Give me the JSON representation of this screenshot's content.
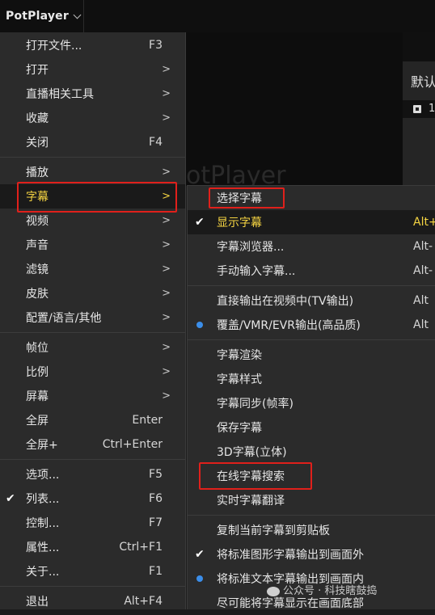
{
  "app": {
    "title": "PotPlayer"
  },
  "video": {
    "watermark": "otPlayer"
  },
  "right_panel": {
    "header": "默认",
    "row_number": "1"
  },
  "main_menu": {
    "items": [
      {
        "label": "打开文件...",
        "shortcut": "F3"
      },
      {
        "label": "打开",
        "submenu": ">"
      },
      {
        "label": "直播相关工具",
        "submenu": ">"
      },
      {
        "label": "收藏",
        "submenu": ">"
      },
      {
        "label": "关闭",
        "shortcut": "F4"
      },
      {
        "label": "播放",
        "submenu": ">"
      },
      {
        "label": "字幕",
        "submenu": ">",
        "highlighted": true
      },
      {
        "label": "视频",
        "submenu": ">"
      },
      {
        "label": "声音",
        "submenu": ">"
      },
      {
        "label": "滤镜",
        "submenu": ">"
      },
      {
        "label": "皮肤",
        "submenu": ">"
      },
      {
        "label": "配置/语言/其他",
        "submenu": ">"
      },
      {
        "label": "帧位",
        "submenu": ">"
      },
      {
        "label": "比例",
        "submenu": ">"
      },
      {
        "label": "屏幕",
        "submenu": ">"
      },
      {
        "label": "全屏",
        "shortcut": "Enter"
      },
      {
        "label": "全屏+",
        "shortcut": "Ctrl+Enter"
      },
      {
        "label": "选项...",
        "shortcut": "F5"
      },
      {
        "label": "列表...",
        "shortcut": "F6",
        "checked": true
      },
      {
        "label": "控制...",
        "shortcut": "F7"
      },
      {
        "label": "属性...",
        "shortcut": "Ctrl+F1"
      },
      {
        "label": "关于...",
        "shortcut": "F1"
      },
      {
        "label": "退出",
        "shortcut": "Alt+F4"
      }
    ]
  },
  "subtitle_menu": {
    "items": [
      {
        "label": "选择字幕"
      },
      {
        "label": "显示字幕",
        "shortcut": "Alt+",
        "checked": true,
        "highlighted": true
      },
      {
        "label": "字幕浏览器...",
        "shortcut": "Alt-"
      },
      {
        "label": "手动输入字幕...",
        "shortcut": "Alt-"
      },
      {
        "label": "直接输出在视频中(TV输出)",
        "shortcut": "Alt"
      },
      {
        "label": "覆盖/VMR/EVR输出(高品质)",
        "shortcut": "Alt",
        "radio": true
      },
      {
        "label": "字幕渲染"
      },
      {
        "label": "字幕样式"
      },
      {
        "label": "字幕同步(帧率)"
      },
      {
        "label": "保存字幕"
      },
      {
        "label": "3D字幕(立体)"
      },
      {
        "label": "在线字幕搜索"
      },
      {
        "label": "实时字幕翻译"
      },
      {
        "label": "复制当前字幕到剪贴板"
      },
      {
        "label": "将标准图形字幕输出到画面外",
        "checked": true
      },
      {
        "label": "将标准文本字幕输出到画面内",
        "radio": true
      },
      {
        "label": "尽可能将字幕显示在画面底部"
      }
    ]
  },
  "icons": {
    "check": "✔",
    "radio": "radio-dot",
    "chevron": "chevron-down-icon"
  },
  "colors": {
    "highlight_text": "#f5d442",
    "annotation_box": "#e0201b",
    "radio_dot": "#3b8eea"
  },
  "watermark": {
    "text": "公众号 · 科技瞎鼓捣"
  }
}
